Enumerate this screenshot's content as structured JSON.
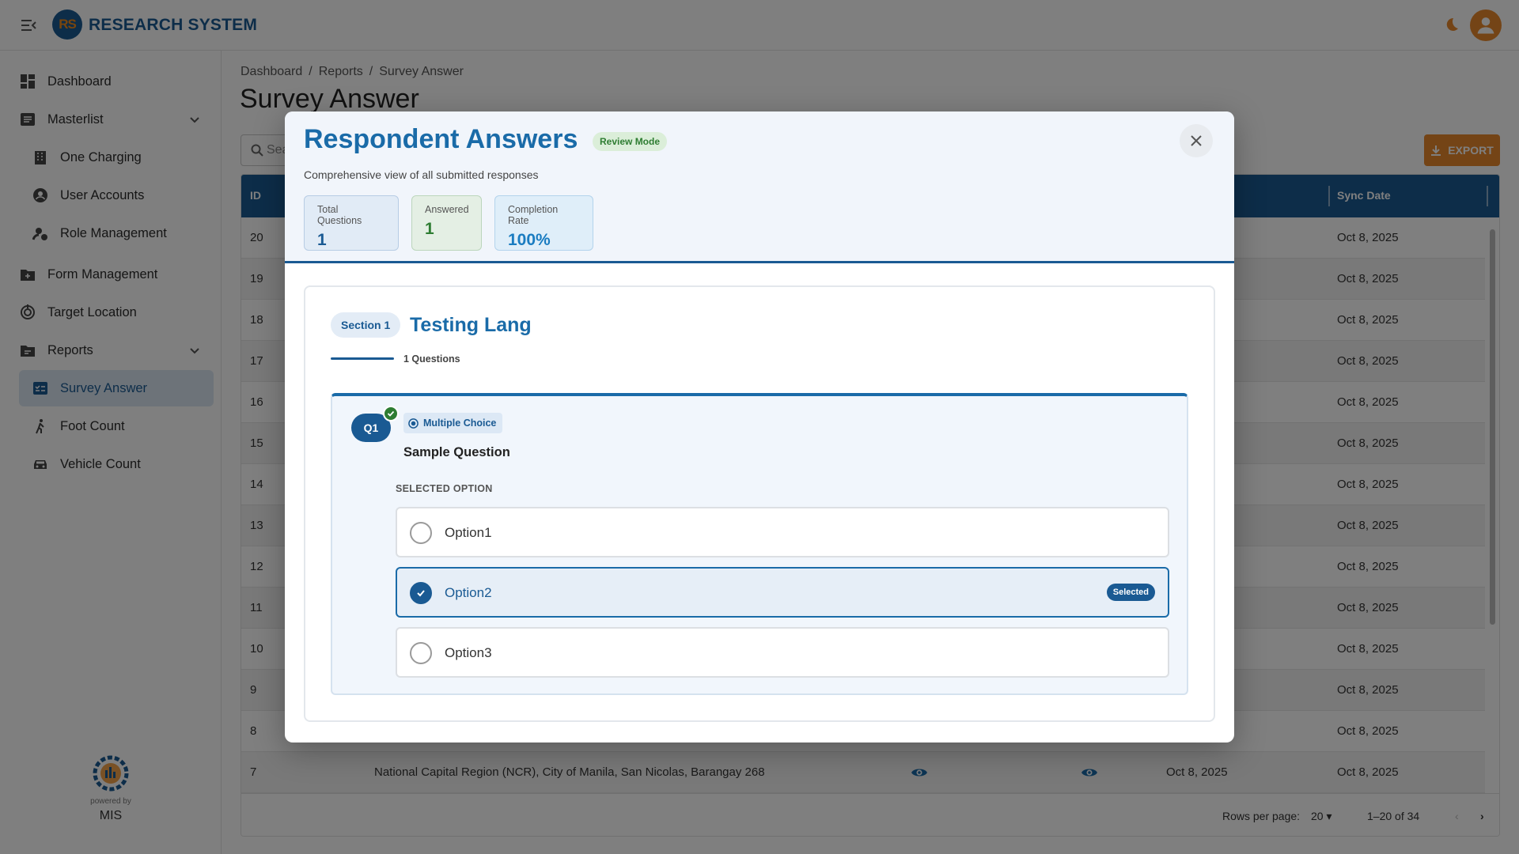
{
  "app": {
    "logo_text": "RS",
    "title": "RESEARCH SYSTEM"
  },
  "sidebar": {
    "items": [
      {
        "label": "Dashboard",
        "icon": "dashboard-icon"
      },
      {
        "label": "Masterlist",
        "icon": "masterlist-icon",
        "expanded": true
      },
      {
        "label": "One Charging",
        "icon": "building-icon"
      },
      {
        "label": "User Accounts",
        "icon": "user-circle-icon"
      },
      {
        "label": "Role Management",
        "icon": "role-icon"
      },
      {
        "label": "Form Management",
        "icon": "folder-plus-icon"
      },
      {
        "label": "Target Location",
        "icon": "target-icon"
      },
      {
        "label": "Reports",
        "icon": "reports-icon",
        "expanded": true
      },
      {
        "label": "Survey Answer",
        "icon": "survey-icon",
        "active": true
      },
      {
        "label": "Foot Count",
        "icon": "walk-icon"
      },
      {
        "label": "Vehicle Count",
        "icon": "car-icon"
      }
    ],
    "powered_by": "powered by",
    "powered_name": "MIS"
  },
  "breadcrumb": [
    "Dashboard",
    "Reports",
    "Survey Answer"
  ],
  "page_title": "Survey Answer",
  "search": {
    "placeholder": "Sea"
  },
  "export_label": "EXPORT",
  "table": {
    "headers": {
      "id": "ID",
      "sync": "Sync Date"
    },
    "rows": [
      {
        "id": "20",
        "sync": "Oct 8, 2025"
      },
      {
        "id": "19",
        "sync": "Oct 8, 2025"
      },
      {
        "id": "18",
        "sync": "Oct 8, 2025"
      },
      {
        "id": "17",
        "sync": "Oct 8, 2025"
      },
      {
        "id": "16",
        "sync": "Oct 8, 2025"
      },
      {
        "id": "15",
        "sync": "Oct 8, 2025"
      },
      {
        "id": "14",
        "sync": "Oct 8, 2025"
      },
      {
        "id": "13",
        "sync": "Oct 8, 2025"
      },
      {
        "id": "12",
        "sync": "Oct 8, 2025"
      },
      {
        "id": "11",
        "sync": "Oct 8, 2025"
      },
      {
        "id": "10",
        "sync": "Oct 8, 2025"
      },
      {
        "id": "9",
        "sync": "Oct 8, 2025"
      },
      {
        "id": "8",
        "sync": "Oct 8, 2025"
      },
      {
        "id": "7",
        "location": "National Capital Region (NCR), City of Manila, San Nicolas, Barangay 268",
        "date": "Oct 8, 2025",
        "sync": "Oct 8, 2025"
      }
    ],
    "rows_per_page_label": "Rows per page:",
    "rows_per_page": "20",
    "range": "1–20 of 34"
  },
  "modal": {
    "title": "Respondent Answers",
    "badge": "Review Mode",
    "subtitle": "Comprehensive view of all submitted responses",
    "stats": [
      {
        "label": "Total Questions",
        "value": "1"
      },
      {
        "label": "Answered",
        "value": "1"
      },
      {
        "label": "Completion Rate",
        "value": "100%"
      }
    ],
    "section": {
      "badge": "Section 1",
      "title": "Testing Lang",
      "count": "1 Questions"
    },
    "question": {
      "number": "Q1",
      "type": "Multiple Choice",
      "text": "Sample Question",
      "selected_label": "SELECTED OPTION",
      "options": [
        {
          "label": "Option1",
          "selected": false
        },
        {
          "label": "Option2",
          "selected": true
        },
        {
          "label": "Option3",
          "selected": false
        }
      ],
      "selected_chip": "Selected"
    }
  },
  "colors": {
    "primary": "#1a5a93",
    "accent": "#e8892d",
    "success": "#2e7d32"
  }
}
